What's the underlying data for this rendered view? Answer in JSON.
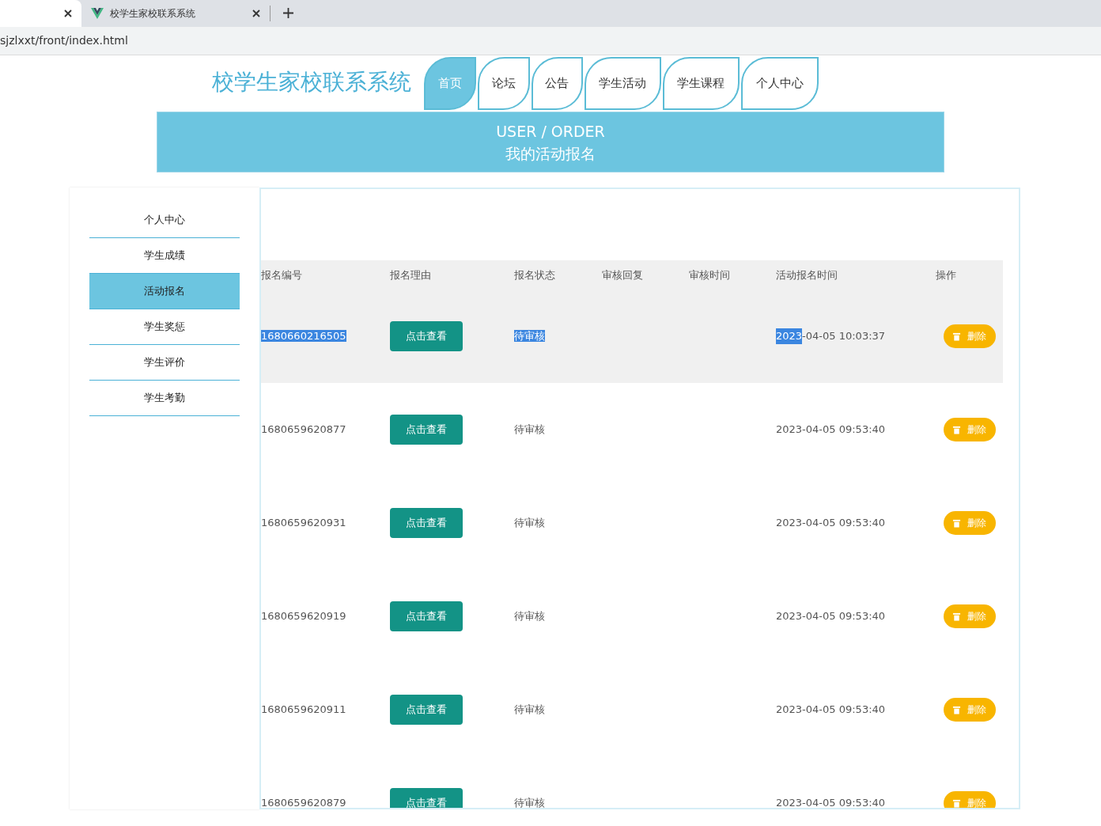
{
  "browser": {
    "tabs": [
      {
        "selected": true
      },
      {
        "title": "校学生家校联系系统",
        "selected": false
      }
    ],
    "address": "sjzlxxt/front/index.html"
  },
  "header": {
    "title": "校学生家校联系系统",
    "nav": [
      {
        "label": "首页",
        "selected": true
      },
      {
        "label": "论坛",
        "selected": false
      },
      {
        "label": "公告",
        "selected": false
      },
      {
        "label": "学生活动",
        "selected": false
      },
      {
        "label": "学生课程",
        "selected": false
      },
      {
        "label": "个人中心",
        "selected": false
      }
    ]
  },
  "banner": {
    "title": "USER / ORDER",
    "subtitle": "我的活动报名"
  },
  "sidebar": {
    "items": [
      {
        "label": "个人中心",
        "selected": false
      },
      {
        "label": "学生成绩",
        "selected": false
      },
      {
        "label": "活动报名",
        "selected": true
      },
      {
        "label": "学生奖惩",
        "selected": false
      },
      {
        "label": "学生评价",
        "selected": false
      },
      {
        "label": "学生考勤",
        "selected": false
      }
    ]
  },
  "table": {
    "columns": [
      "报名编号",
      "报名理由",
      "报名状态",
      "审核回复",
      "审核时间",
      "活动报名时间",
      "操作"
    ],
    "rows": [
      {
        "highlighted": true,
        "id": {
          "text": "1680660216505",
          "selected": true
        },
        "reason_button": "点击查看",
        "status": {
          "text": "待审核",
          "selected": true
        },
        "time": [
          {
            "text": "2023",
            "selected": true
          },
          {
            "text": "-04-05 10:03:37",
            "selected": false
          }
        ],
        "delete_button": "删除"
      },
      {
        "highlighted": false,
        "id": {
          "text": "1680659620877",
          "selected": false
        },
        "reason_button": "点击查看",
        "status": {
          "text": "待审核",
          "selected": false
        },
        "time": [
          {
            "text": "2023-04-05 09:53:40",
            "selected": false
          }
        ],
        "delete_button": "删除"
      },
      {
        "highlighted": false,
        "id": {
          "text": "1680659620931",
          "selected": false
        },
        "reason_button": "点击查看",
        "status": {
          "text": "待审核",
          "selected": false
        },
        "time": [
          {
            "text": "2023-04-05 09:53:40",
            "selected": false
          }
        ],
        "delete_button": "删除"
      },
      {
        "highlighted": false,
        "id": {
          "text": "1680659620919",
          "selected": false
        },
        "reason_button": "点击查看",
        "status": {
          "text": "待审核",
          "selected": false
        },
        "time": [
          {
            "text": "2023-04-05 09:53:40",
            "selected": false
          }
        ],
        "delete_button": "删除"
      },
      {
        "highlighted": false,
        "id": {
          "text": "1680659620911",
          "selected": false
        },
        "reason_button": "点击查看",
        "status": {
          "text": "待审核",
          "selected": false
        },
        "time": [
          {
            "text": "2023-04-05 09:53:40",
            "selected": false
          }
        ],
        "delete_button": "删除"
      },
      {
        "highlighted": false,
        "id": {
          "text": "1680659620879",
          "selected": false
        },
        "reason_button": "点击查看",
        "status": {
          "text": "待审核",
          "selected": false
        },
        "time": [
          {
            "text": "2023-04-05 09:53:40",
            "selected": false
          }
        ],
        "delete_button": "删除"
      }
    ]
  }
}
